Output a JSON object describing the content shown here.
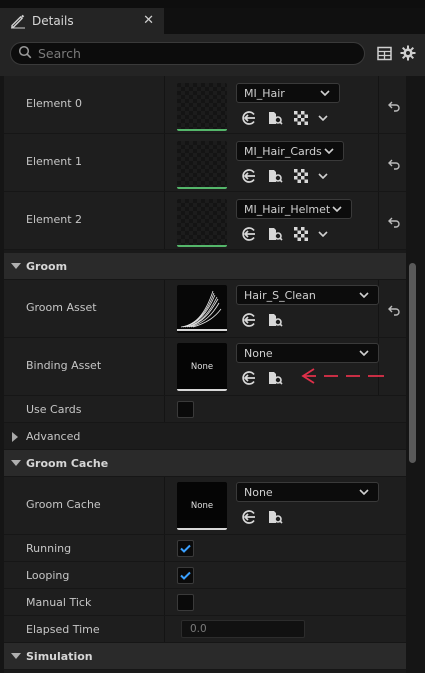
{
  "tab": {
    "title": "Details",
    "close": "✕"
  },
  "search": {
    "placeholder": "Search"
  },
  "toolbar": {
    "table_icon": "table-icon",
    "settings_icon": "gear-icon"
  },
  "materials": [
    {
      "label": "Element 0",
      "material": "MI_Hair"
    },
    {
      "label": "Element 1",
      "material": "MI_Hair_Cards"
    },
    {
      "label": "Element 2",
      "material": "MI_Hair_Helmet"
    }
  ],
  "groom_section": {
    "title": "Groom",
    "groom_asset": {
      "label": "Groom Asset",
      "value": "Hair_S_Clean"
    },
    "binding_asset": {
      "label": "Binding Asset",
      "value": "None",
      "thumb": "None"
    },
    "use_cards": {
      "label": "Use Cards",
      "checked": false
    }
  },
  "advanced": {
    "title": "Advanced"
  },
  "groom_cache_section": {
    "title": "Groom Cache",
    "groom_cache": {
      "label": "Groom Cache",
      "value": "None",
      "thumb": "None"
    },
    "running": {
      "label": "Running",
      "checked": true
    },
    "looping": {
      "label": "Looping",
      "checked": true
    },
    "manual_tick": {
      "label": "Manual Tick",
      "checked": false
    },
    "elapsed_time": {
      "label": "Elapsed Time",
      "value": "0.0"
    }
  },
  "simulation": {
    "title": "Simulation"
  },
  "colors": {
    "accent_green": "#54b66a",
    "annotation_red": "#e0304a",
    "check_blue": "#3aa0ff"
  }
}
